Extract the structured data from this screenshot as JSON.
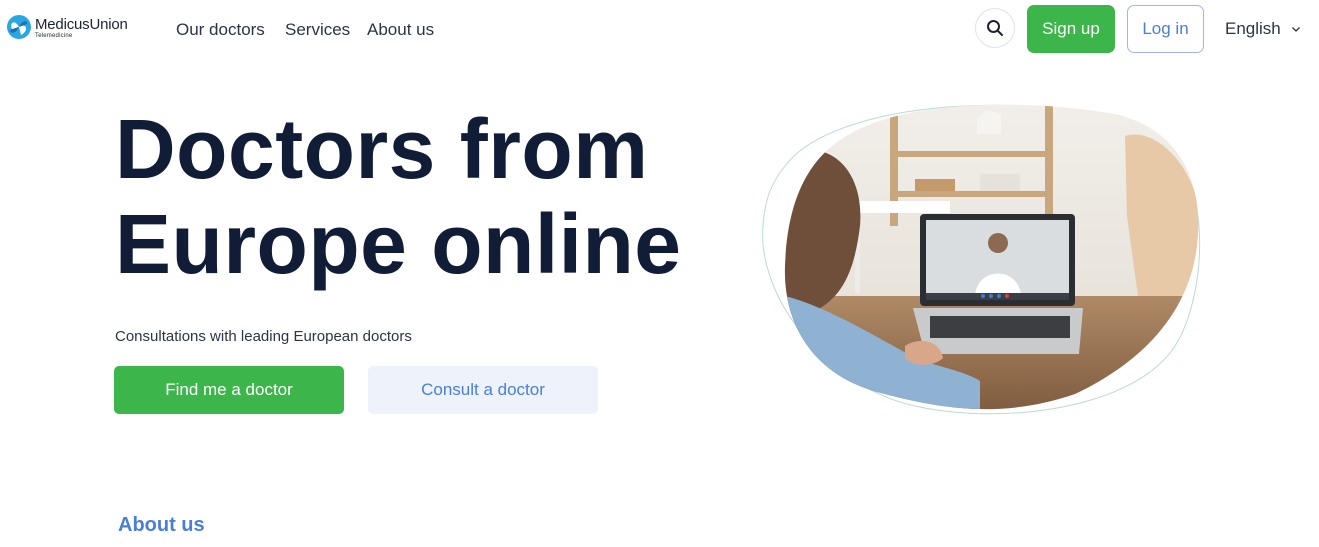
{
  "brand": {
    "name": "MedicusUnion",
    "tagline": "Telemedicine",
    "logo_icon": "medicus-union-logo",
    "colors": {
      "primary_green": "#3cb54a",
      "link_blue": "#4a7fd6",
      "heading_navy": "#111c36",
      "secondary_bg": "#eef2fb"
    }
  },
  "nav": {
    "items": [
      {
        "label": "Our doctors"
      },
      {
        "label": "Services"
      },
      {
        "label": "About us"
      }
    ]
  },
  "header": {
    "search_icon": "search-icon",
    "signup_label": "Sign up",
    "login_label": "Log in",
    "language": "English",
    "language_icon": "chevron-down-icon"
  },
  "hero": {
    "title_line1": "Doctors from",
    "title_line2": "Europe online",
    "subtitle": "Consultations with leading European doctors",
    "primary_cta": "Find me a doctor",
    "secondary_cta": "Consult a doctor"
  },
  "sections": {
    "about_title": "About us"
  }
}
